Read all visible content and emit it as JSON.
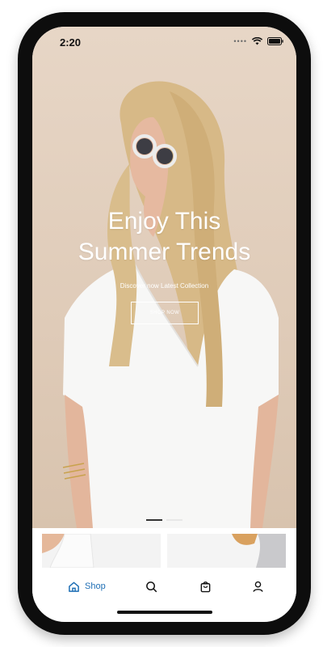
{
  "status_bar": {
    "time": "2:20",
    "signal_dots": "••••"
  },
  "hero": {
    "title_line1": "Enjoy This",
    "title_line2": "Summer Trends",
    "subtitle": "Discover now Latest Collection",
    "cta_label": "SHOP NOW",
    "page_count": 2,
    "active_page": 1
  },
  "bottom_nav": {
    "items": [
      {
        "label": "Shop",
        "icon": "home-icon",
        "active": true
      },
      {
        "label": "",
        "icon": "search-icon",
        "active": false
      },
      {
        "label": "",
        "icon": "shopping-bag-icon",
        "active": false
      },
      {
        "label": "",
        "icon": "profile-icon",
        "active": false
      }
    ]
  },
  "colors": {
    "hero_background": "#e3d1bf",
    "accent": "#1f6fb5",
    "frame": "#0d0d0d"
  }
}
